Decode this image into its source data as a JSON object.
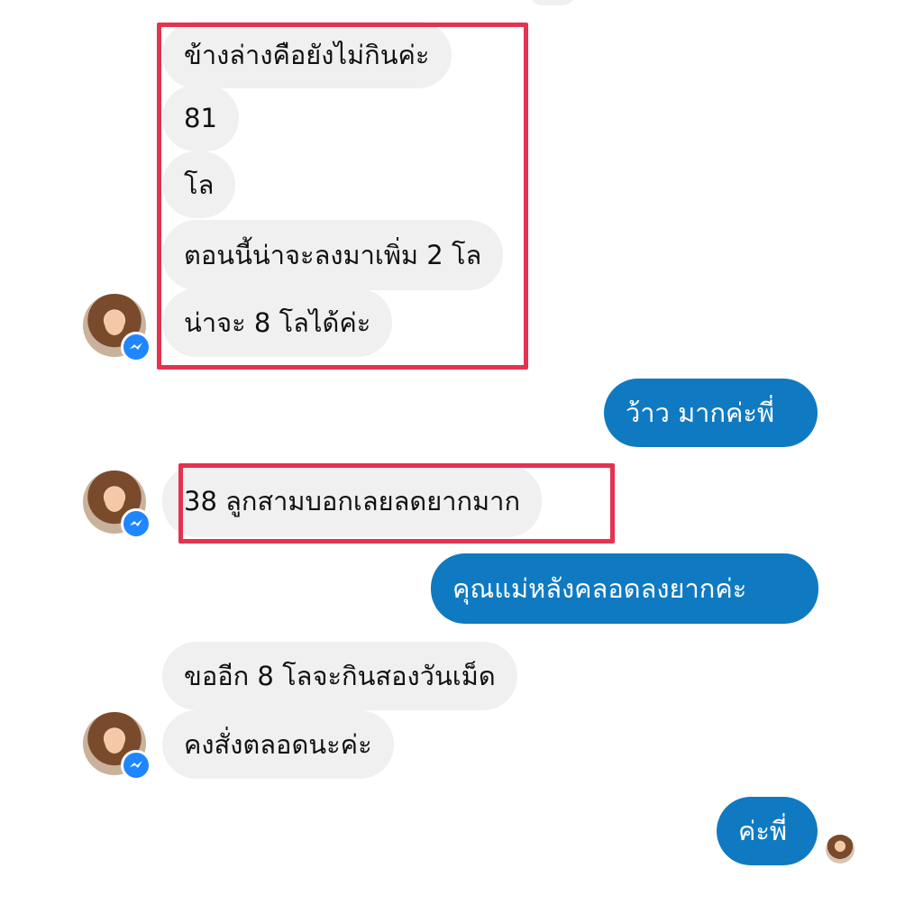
{
  "colors": {
    "incoming_bubble": "#f1f0f0",
    "outgoing_bubble": "#0f7ac2",
    "highlight_box": "#e4324f",
    "messenger_badge": "#1f86ff"
  },
  "icons": {
    "avatar": "contact-avatar",
    "badge": "messenger-icon",
    "read_receipt": "seen-avatar"
  },
  "messages": [
    {
      "sender": "contact",
      "text": "ข้างล่างคือยังไม่กินค่ะ"
    },
    {
      "sender": "contact",
      "text": "81"
    },
    {
      "sender": "contact",
      "text": "โล"
    },
    {
      "sender": "contact",
      "text": "ตอนนี้น่าจะลงมาเพิ่ม 2 โล"
    },
    {
      "sender": "contact",
      "text": "น่าจะ 8 โลได้ค่ะ"
    },
    {
      "sender": "me",
      "text": "ว้าว มากค่ะพี่"
    },
    {
      "sender": "contact",
      "text": "38 ลูกสามบอกเลยลดยากมาก"
    },
    {
      "sender": "me",
      "text": "คุณแม่หลังคลอดลงยากค่ะ"
    },
    {
      "sender": "contact",
      "text": "ขออีก 8 โลจะกินสองวันเม็ด"
    },
    {
      "sender": "contact",
      "text": "คงสั่งตลอดนะค่ะ"
    },
    {
      "sender": "me",
      "text": "ค่ะพี่"
    }
  ]
}
